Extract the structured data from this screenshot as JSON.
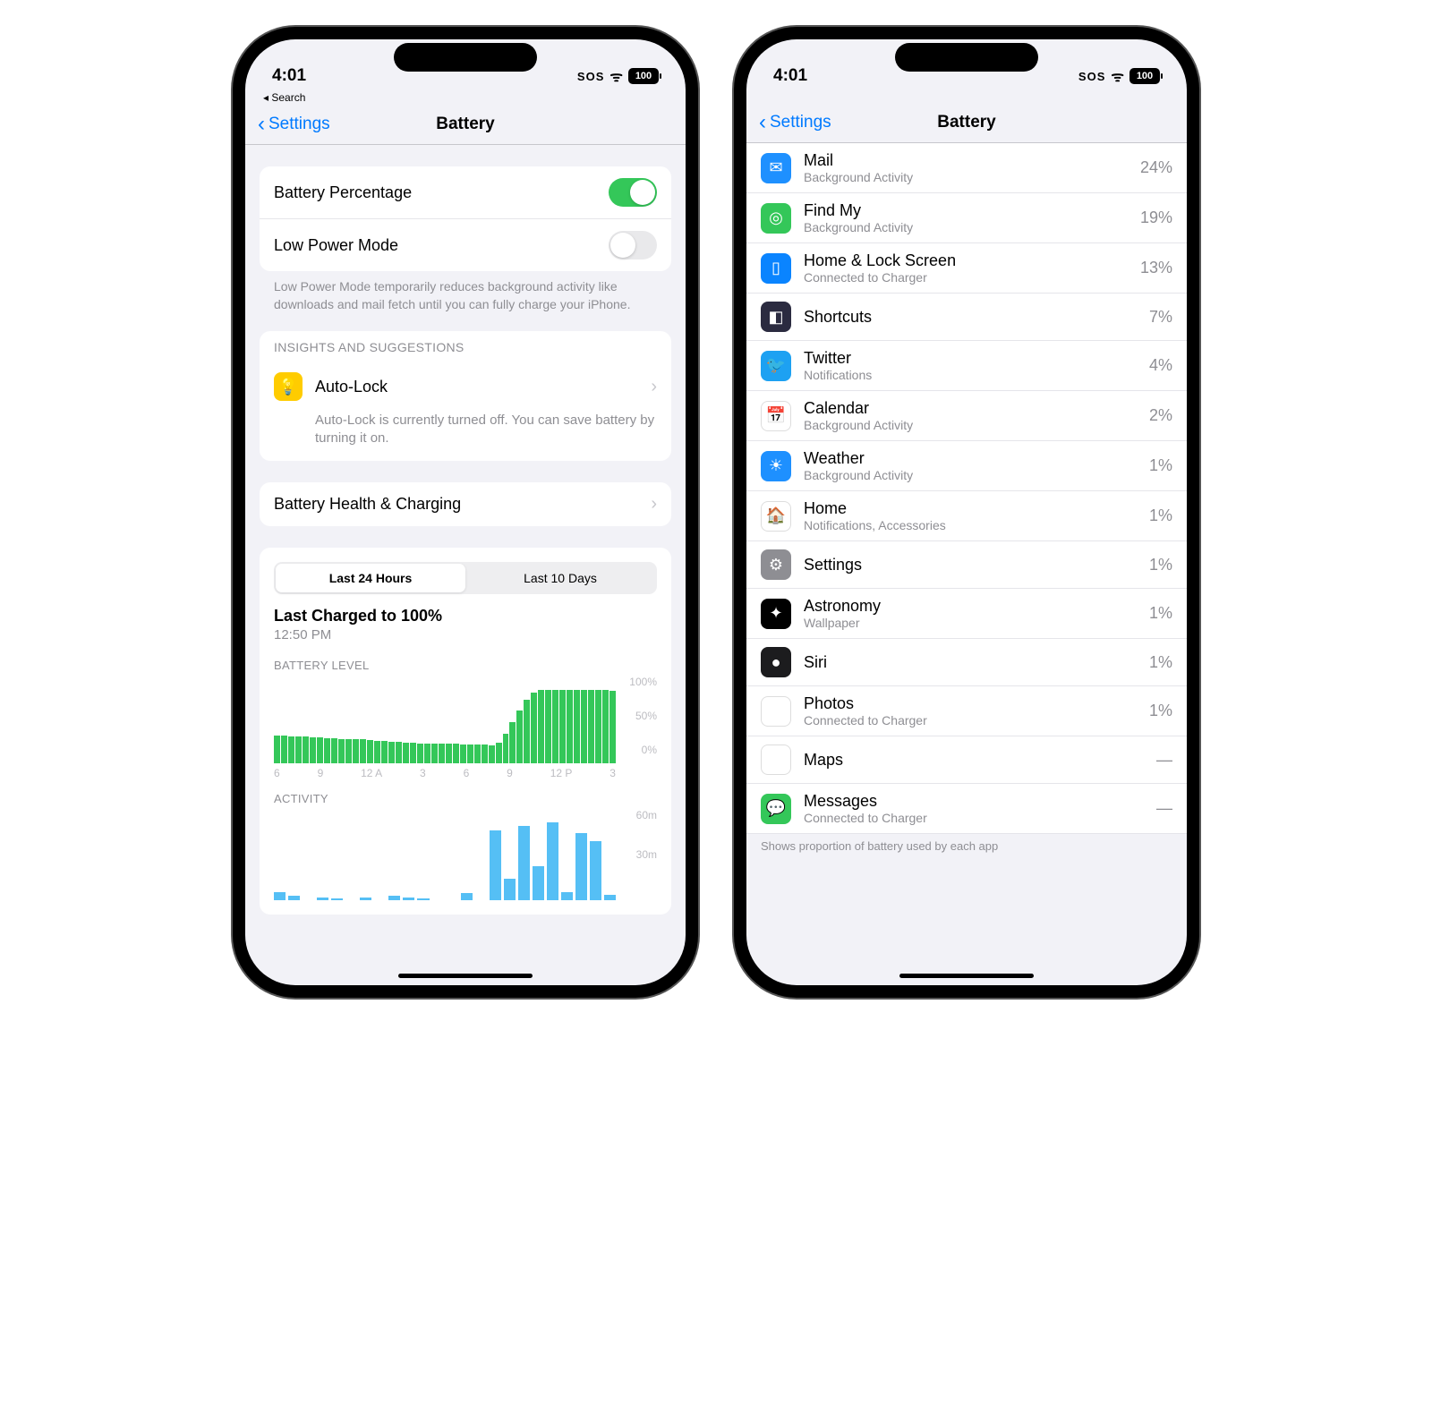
{
  "status": {
    "time": "4:01",
    "sos": "SOS",
    "battery": "100"
  },
  "breadcrumb": "◂ Search",
  "nav": {
    "back": "Settings",
    "title": "Battery"
  },
  "left": {
    "batteryPercentage": "Battery Percentage",
    "lowPower": "Low Power Mode",
    "lowPowerDesc": "Low Power Mode temporarily reduces background activity like downloads and mail fetch until you can fully charge your iPhone.",
    "insightsHeader": "INSIGHTS AND SUGGESTIONS",
    "autoLock": "Auto-Lock",
    "autoLockDesc": "Auto-Lock is currently turned off. You can save battery by turning it on.",
    "batteryHealth": "Battery Health & Charging",
    "seg24": "Last 24 Hours",
    "seg10": "Last 10 Days",
    "lastCharged": "Last Charged to 100%",
    "lastChargedTime": "12:50 PM",
    "levelLabel": "BATTERY LEVEL",
    "activityLabel": "ACTIVITY",
    "yLabels": {
      "top": "100%",
      "mid": "50%",
      "bot": "0%"
    },
    "xLabels": [
      "6",
      "9",
      "12 A",
      "3",
      "6",
      "9",
      "12 P",
      "3"
    ],
    "actY": {
      "top": "60m",
      "mid": "30m"
    }
  },
  "right": {
    "apps": [
      {
        "name": "Mail",
        "sub": "Background Activity",
        "pct": "24%",
        "bg": "#1e90ff",
        "glyph": "✉"
      },
      {
        "name": "Find My",
        "sub": "Background Activity",
        "pct": "19%",
        "bg": "#34c759",
        "glyph": "◎"
      },
      {
        "name": "Home & Lock Screen",
        "sub": "Connected to Charger",
        "pct": "13%",
        "bg": "#0a84ff",
        "glyph": "▯"
      },
      {
        "name": "Shortcuts",
        "sub": "",
        "pct": "7%",
        "bg": "#2b2b40",
        "glyph": "◧"
      },
      {
        "name": "Twitter",
        "sub": "Notifications",
        "pct": "4%",
        "bg": "#1da1f2",
        "glyph": "🐦"
      },
      {
        "name": "Calendar",
        "sub": "Background Activity",
        "pct": "2%",
        "bg": "#ffffff",
        "glyph": "📅"
      },
      {
        "name": "Weather",
        "sub": "Background Activity",
        "pct": "1%",
        "bg": "#1e90ff",
        "glyph": "☀"
      },
      {
        "name": "Home",
        "sub": "Notifications, Accessories",
        "pct": "1%",
        "bg": "#ffffff",
        "glyph": "🏠"
      },
      {
        "name": "Settings",
        "sub": "",
        "pct": "1%",
        "bg": "#8e8e93",
        "glyph": "⚙"
      },
      {
        "name": "Astronomy",
        "sub": "Wallpaper",
        "pct": "1%",
        "bg": "#000000",
        "glyph": "✦"
      },
      {
        "name": "Siri",
        "sub": "",
        "pct": "1%",
        "bg": "#1c1c1e",
        "glyph": "●"
      },
      {
        "name": "Photos",
        "sub": "Connected to Charger",
        "pct": "1%",
        "bg": "#ffffff",
        "glyph": "✿"
      },
      {
        "name": "Maps",
        "sub": "",
        "pct": "—",
        "bg": "#ffffff",
        "glyph": "▲"
      },
      {
        "name": "Messages",
        "sub": "Connected to Charger",
        "pct": "—",
        "bg": "#34c759",
        "glyph": "💬"
      }
    ],
    "footnote": "Shows proportion of battery used by each app"
  },
  "chart_data": {
    "battery_level": {
      "type": "bar",
      "title": "BATTERY LEVEL",
      "ylabel": "%",
      "ylim": [
        0,
        100
      ],
      "x_ticks": [
        "6",
        "9",
        "12 A",
        "3",
        "6",
        "9",
        "12 P",
        "3"
      ],
      "values": [
        38,
        37,
        36,
        36,
        36,
        35,
        35,
        34,
        34,
        33,
        33,
        32,
        32,
        31,
        30,
        30,
        29,
        29,
        28,
        28,
        27,
        27,
        27,
        26,
        26,
        26,
        25,
        25,
        25,
        25,
        24,
        28,
        40,
        56,
        72,
        86,
        96,
        100,
        100,
        100,
        100,
        100,
        100,
        100,
        100,
        100,
        100,
        99
      ],
      "charging_span_index": [
        31,
        37
      ]
    },
    "activity": {
      "type": "bar",
      "title": "ACTIVITY",
      "ylabel": "minutes",
      "ylim": [
        0,
        60
      ],
      "values": [
        6,
        3,
        0,
        2,
        1,
        0,
        2,
        0,
        3,
        2,
        1,
        0,
        0,
        5,
        0,
        52,
        16,
        55,
        25,
        58,
        6,
        50,
        44,
        4
      ]
    }
  }
}
